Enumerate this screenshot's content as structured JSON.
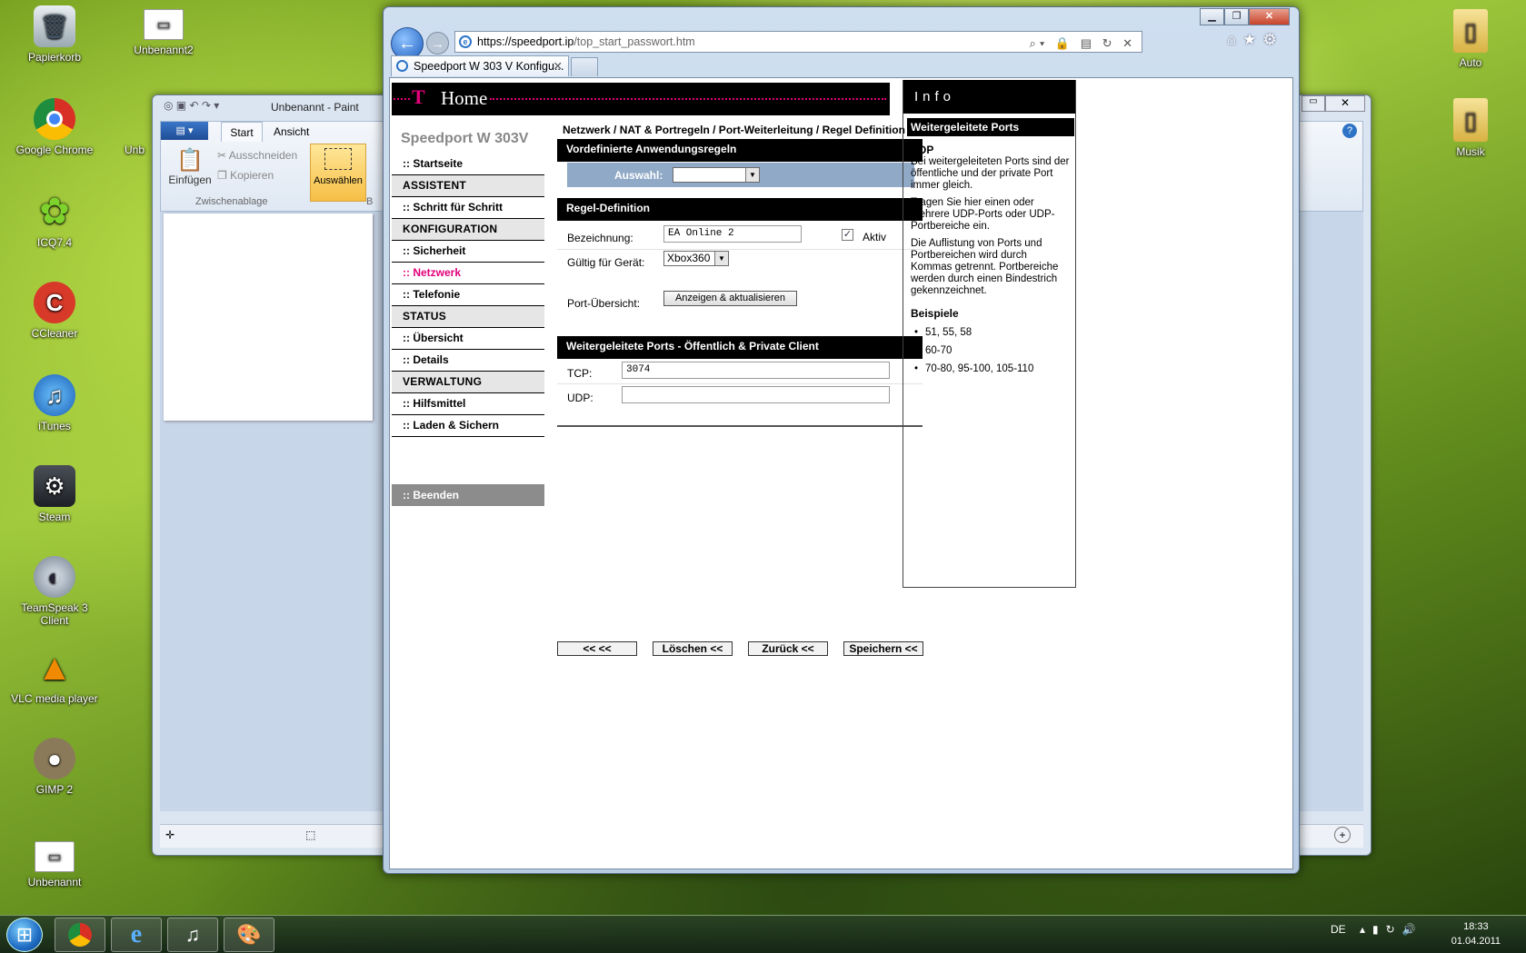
{
  "desktop": {
    "icons": [
      {
        "label": "Papierkorb",
        "icon": "trash-icon"
      },
      {
        "label": "Unbenannt2",
        "icon": "image-file-icon"
      },
      {
        "label": "Google Chrome",
        "icon": "chrome-icon"
      },
      {
        "label": "ICQ7.4",
        "icon": "icq-flower-icon"
      },
      {
        "label": "CCleaner",
        "icon": "ccleaner-icon"
      },
      {
        "label": "iTunes",
        "icon": "itunes-icon"
      },
      {
        "label": "Steam",
        "icon": "steam-icon"
      },
      {
        "label": "TeamSpeak 3 Client",
        "icon": "teamspeak-icon"
      },
      {
        "label": "VLC media player",
        "icon": "vlc-cone-icon"
      },
      {
        "label": "GIMP 2",
        "icon": "gimp-icon"
      },
      {
        "label": "Unbenannt",
        "icon": "image-file-icon"
      },
      {
        "label": "Auto",
        "icon": "folder-icon"
      },
      {
        "label": "Musik",
        "icon": "folder-icon"
      }
    ],
    "partial_label": "Unb"
  },
  "paint": {
    "title": "Unbenannt - Paint",
    "tabs": [
      "Start",
      "Ansicht"
    ],
    "einfuegen": "Einfügen",
    "ausschneiden": "Ausschneiden",
    "kopieren": "Kopieren",
    "auswaehlen": "Auswählen",
    "zwischenablage": "Zwischenablage",
    "partial_b": "B"
  },
  "browser": {
    "url": "https://speedport.ip/top_start_passwort.htm",
    "url_host": "https://speedport.ip",
    "url_path": "/top_start_passwort.htm",
    "tab_title": "Speedport W 303 V Konfigu...",
    "tab_close": "✕"
  },
  "router": {
    "header_t": "T",
    "header_home": "Home",
    "model": "Speedport W 303V",
    "menu": [
      {
        "type": "item",
        "label": ":: Startseite"
      },
      {
        "type": "header",
        "label": "ASSISTENT"
      },
      {
        "type": "item",
        "label": ":: Schritt für Schritt"
      },
      {
        "type": "header",
        "label": "KONFIGURATION"
      },
      {
        "type": "item",
        "label": ":: Sicherheit"
      },
      {
        "type": "item",
        "label": ":: Netzwerk",
        "active": true
      },
      {
        "type": "item",
        "label": ":: Telefonie"
      },
      {
        "type": "header",
        "label": "STATUS"
      },
      {
        "type": "item",
        "label": ":: Übersicht"
      },
      {
        "type": "item",
        "label": ":: Details"
      },
      {
        "type": "header",
        "label": "VERWALTUNG"
      },
      {
        "type": "item",
        "label": ":: Hilfsmittel"
      },
      {
        "type": "item",
        "label": ":: Laden & Sichern"
      }
    ],
    "beenden": ":: Beenden",
    "breadcrumb": "Netzwerk / NAT & Portregeln / Port-Weiterleitung / Regel Definition",
    "section_predefined": "Vordefinierte Anwendungsregeln",
    "auswahl_label": "Auswahl:",
    "auswahl_value": "",
    "section_rule": "Regel-Definition",
    "bezeichnung_label": "Bezeichnung:",
    "bezeichnung_value": "EA Online 2",
    "aktiv_label": "Aktiv",
    "aktiv_checked": true,
    "geraet_label": "Gültig für Gerät:",
    "geraet_value": "Xbox360",
    "portuebersicht_label": "Port-Übersicht:",
    "portuebersicht_button": "Anzeigen & aktualisieren",
    "section_ports": "Weitergeleitete Ports - Öffentlich & Private Client",
    "tcp_label": "TCP:",
    "tcp_value": "3074",
    "udp_label": "UDP:",
    "udp_value": "",
    "buttons": {
      "first": "<< <<",
      "delete": "Löschen <<",
      "back": "Zurück <<",
      "save": "Speichern <<"
    }
  },
  "info": {
    "title": "Info",
    "subtitle": "Weitergeleitete Ports",
    "heading": "UDP",
    "p1": "Bei weitergeleiteten Ports sind der öffentliche und der private Port immer gleich.",
    "p2": "Tragen Sie hier einen oder mehrere UDP-Ports oder UDP-Portbereiche ein.",
    "p3": "Die Auflistung von Ports und Portbereichen wird durch Kommas getrennt. Portbereiche werden durch einen Bindestrich gekennzeichnet.",
    "examples_title": "Beispiele",
    "examples": [
      "51, 55, 58",
      "60-70",
      "70-80, 95-100, 105-110"
    ]
  },
  "taskbar": {
    "lang": "DE",
    "time": "18:33",
    "date": "01.04.2011"
  }
}
